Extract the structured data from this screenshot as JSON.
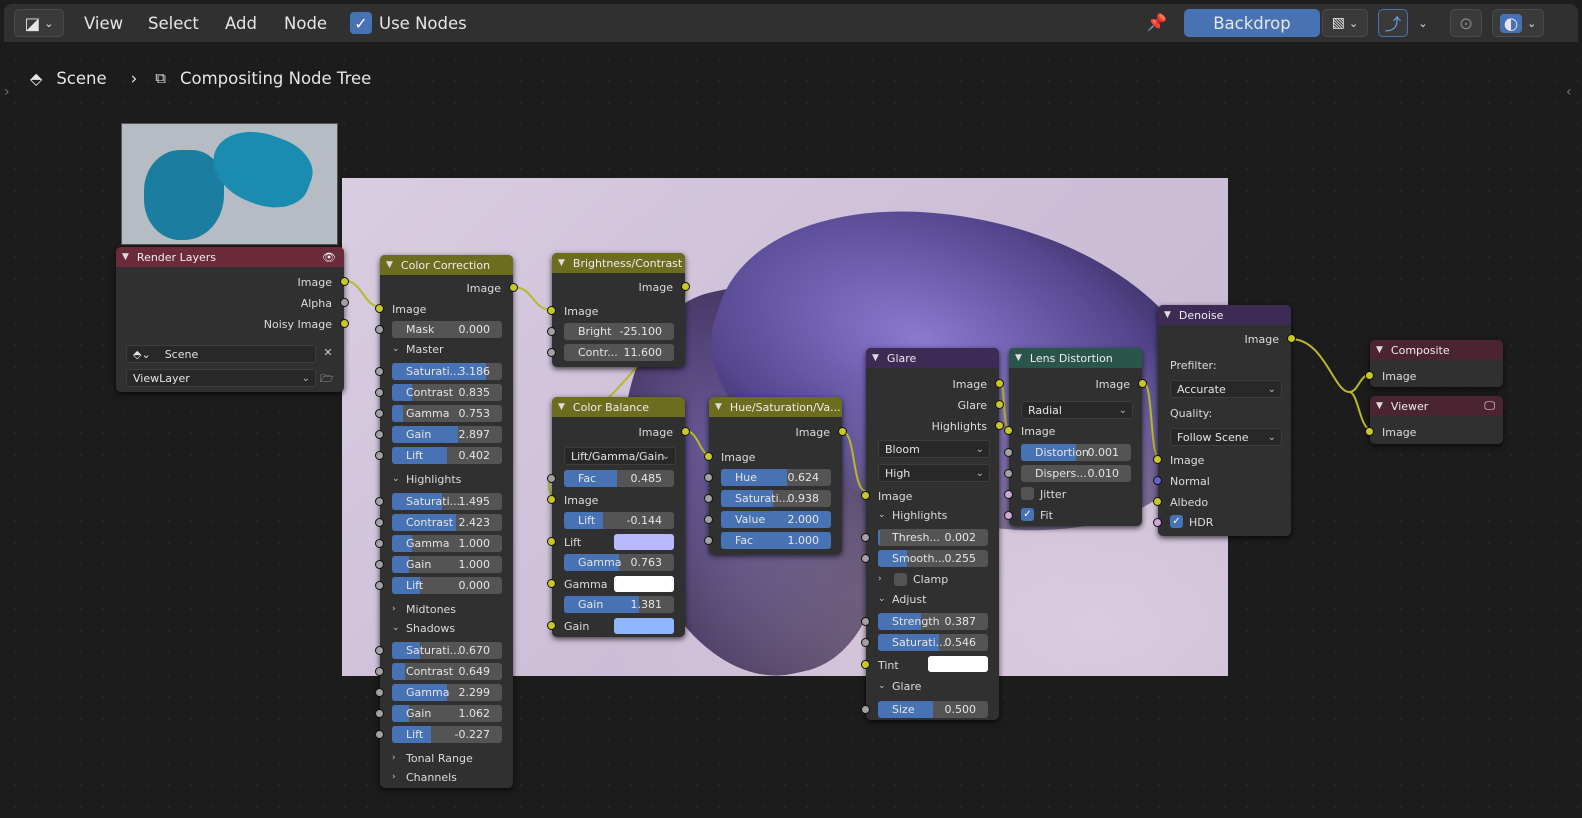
{
  "header": {
    "menus": [
      "View",
      "Select",
      "Add",
      "Node"
    ],
    "use_nodes_label": "Use Nodes",
    "use_nodes_checked": true,
    "backdrop_label": "Backdrop"
  },
  "breadcrumb": {
    "scene": "Scene",
    "tree": "Compositing Node Tree"
  },
  "colors": {
    "accent": "#4772b3",
    "image_socket": "#c7c729",
    "float_socket": "#a1a1a1",
    "vector_socket": "#6363c7",
    "link": "#b8b82a"
  },
  "nodes": {
    "render_layers": {
      "title": "Render Layers",
      "outputs": [
        "Image",
        "Alpha",
        "Noisy Image"
      ],
      "scene": "Scene",
      "view_layer": "ViewLayer"
    },
    "color_correction": {
      "title": "Color Correction",
      "output": "Image",
      "input": "Image",
      "mask_label": "Mask",
      "mask_value": "0.000",
      "master_label": "Master",
      "master": [
        {
          "label": "Saturati...",
          "value": "3.186",
          "fill": 0.85
        },
        {
          "label": "Contrast",
          "value": "0.835",
          "fill": 0.18
        },
        {
          "label": "Gamma",
          "value": "0.753",
          "fill": 0.1
        },
        {
          "label": "Gain",
          "value": "2.897",
          "fill": 0.6
        },
        {
          "label": "Lift",
          "value": "0.402",
          "fill": 0.5
        }
      ],
      "highlights_label": "Highlights",
      "highlights": [
        {
          "label": "Saturati...",
          "value": "1.495",
          "fill": 0.45
        },
        {
          "label": "Contrast",
          "value": "2.423",
          "fill": 0.58
        },
        {
          "label": "Gamma",
          "value": "1.000",
          "fill": 0.18
        },
        {
          "label": "Gain",
          "value": "1.000",
          "fill": 0.15
        },
        {
          "label": "Lift",
          "value": "0.000",
          "fill": 0.25
        }
      ],
      "midtones_label": "Midtones",
      "shadows_label": "Shadows",
      "shadows": [
        {
          "label": "Saturati...",
          "value": "0.670",
          "fill": 0.25
        },
        {
          "label": "Contrast",
          "value": "0.649",
          "fill": 0.12
        },
        {
          "label": "Gamma",
          "value": "2.299",
          "fill": 0.5
        },
        {
          "label": "Gain",
          "value": "1.062",
          "fill": 0.15
        },
        {
          "label": "Lift",
          "value": "-0.227",
          "fill": 0.35
        }
      ],
      "tonal_range_label": "Tonal Range",
      "channels_label": "Channels"
    },
    "brightness_contrast": {
      "title": "Brightness/Contrast",
      "output": "Image",
      "input": "Image",
      "bright_label": "Bright",
      "bright_value": "-25.100",
      "contrast_label": "Contr...",
      "contrast_value": "11.600"
    },
    "color_balance": {
      "title": "Color Balance",
      "output": "Image",
      "mode": "Lift/Gamma/Gain",
      "fac_label": "Fac",
      "fac_value": "0.485",
      "fac_fill": 0.48,
      "image_label": "Image",
      "lift_field_label": "Lift",
      "lift_field_value": "-0.144",
      "lift_fill": 0.35,
      "lift_label": "Lift",
      "lift_color": "#b9b9ff",
      "gamma_field_label": "Gamma",
      "gamma_field_value": "0.763",
      "gamma_fill": 0.5,
      "gamma_label": "Gamma",
      "gamma_color": "#ffffff",
      "gain_field_label": "Gain",
      "gain_field_value": "1.381",
      "gain_fill": 0.68,
      "gain_label": "Gain",
      "gain_color": "#8eb7ff"
    },
    "hue_sat": {
      "title": "Hue/Saturation/Va...",
      "output": "Image",
      "input": "Image",
      "fields": [
        {
          "label": "Hue",
          "value": "0.624",
          "fill": 0.6
        },
        {
          "label": "Saturati...",
          "value": "0.938",
          "fill": 0.47
        },
        {
          "label": "Value",
          "value": "2.000",
          "fill": 1.0
        },
        {
          "label": "Fac",
          "value": "1.000",
          "fill": 1.0
        }
      ]
    },
    "glare": {
      "title": "Glare",
      "outputs": [
        "Image",
        "Glare",
        "Highlights"
      ],
      "type": "Bloom",
      "quality": "High",
      "input": "Image",
      "highlights_label": "Highlights",
      "threshold_label": "Thresh...",
      "threshold_value": "0.002",
      "smooth_label": "Smooth...",
      "smooth_value": "0.255",
      "clamp_label": "Clamp",
      "adjust_label": "Adjust",
      "strength_label": "Strength",
      "strength_value": "0.387",
      "saturation_label": "Saturati...",
      "saturation_value": "0.546",
      "tint_label": "Tint",
      "glare_label": "Glare",
      "size_label": "Size",
      "size_value": "0.500"
    },
    "lens_distortion": {
      "title": "Lens Distortion",
      "output": "Image",
      "mode": "Radial",
      "input": "Image",
      "distortion_label": "Distortion",
      "distortion_value": "0.001",
      "dispersion_label": "Dispers...",
      "dispersion_value": "0.010",
      "jitter_label": "Jitter",
      "jitter_checked": false,
      "fit_label": "Fit",
      "fit_checked": true
    },
    "denoise": {
      "title": "Denoise",
      "output": "Image",
      "prefilter_label": "Prefilter:",
      "prefilter": "Accurate",
      "quality_label": "Quality:",
      "quality": "Follow Scene",
      "inputs": [
        "Image",
        "Normal",
        "Albedo"
      ],
      "hdr_label": "HDR",
      "hdr_checked": true
    },
    "composite": {
      "title": "Composite",
      "input": "Image"
    },
    "viewer": {
      "title": "Viewer",
      "input": "Image"
    }
  }
}
